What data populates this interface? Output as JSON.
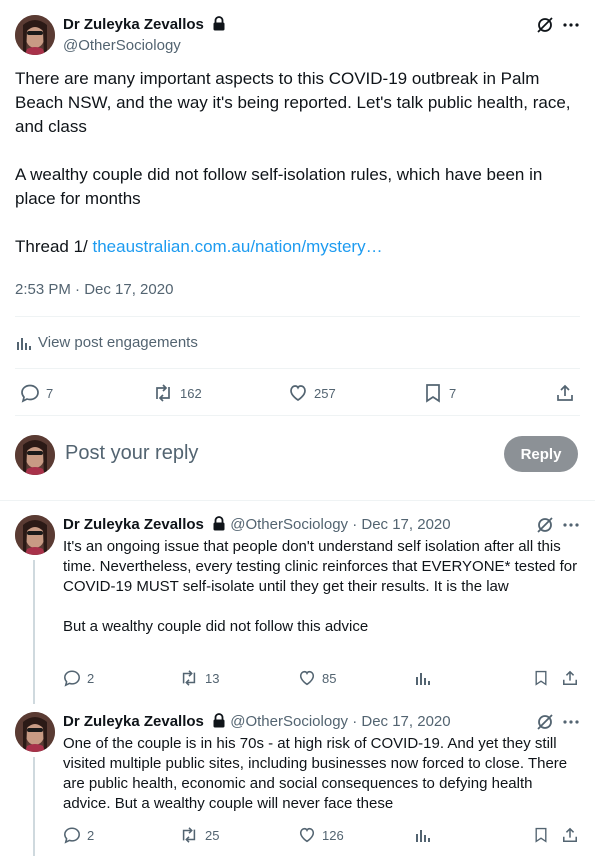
{
  "main_tweet": {
    "author_name": "Dr Zuleyka Zevallos",
    "handle": "@OtherSociology",
    "paragraph1": "There are many important aspects to this COVID-19 outbreak in Palm Beach NSW, and the way it's being reported. Let's talk public health, race, and class",
    "paragraph2": "A wealthy couple did not follow self-isolation rules, which have been in place for months",
    "thread_label": "Thread 1/",
    "link_text": "theaustralian.com.au/nation/mystery…",
    "timestamp": "2:53 PM · Dec 17, 2020",
    "engagements_label": "View post engagements",
    "replies": "7",
    "reposts": "162",
    "likes": "257",
    "bookmarks": "7"
  },
  "compose": {
    "placeholder": "Post your reply",
    "button_label": "Reply"
  },
  "replies": [
    {
      "author_name": "Dr Zuleyka Zevallos",
      "handle": "@OtherSociology",
      "date": "· Dec 17, 2020",
      "paragraph1": "It's an ongoing issue that people don't understand self isolation after all this time. Nevertheless, every testing clinic reinforces that EVERYONE* tested for COVID-19 MUST self-isolate until they get their results. It is the law",
      "paragraph2": "But a wealthy couple did not follow this advice",
      "replies": "2",
      "reposts": "13",
      "likes": "85"
    },
    {
      "author_name": "Dr Zuleyka Zevallos",
      "handle": "@OtherSociology",
      "date": "· Dec 17, 2020",
      "paragraph1": "One of the couple is in his 70s - at high risk of COVID-19. And yet they still visited multiple public sites, including businesses now forced to close. There are public health, economic and social consequences to defying health advice. But a wealthy couple will never face these",
      "replies": "2",
      "reposts": "25",
      "likes": "126"
    }
  ],
  "icons": [
    "avatar",
    "lock-icon",
    "grok-icon",
    "more-icon",
    "reply-icon",
    "repost-icon",
    "like-icon",
    "bookmark-icon",
    "share-icon",
    "analytics-icon"
  ],
  "colors": {
    "link": "#1d9bf0",
    "muted": "#536471",
    "reply_button": "#8c9196"
  }
}
